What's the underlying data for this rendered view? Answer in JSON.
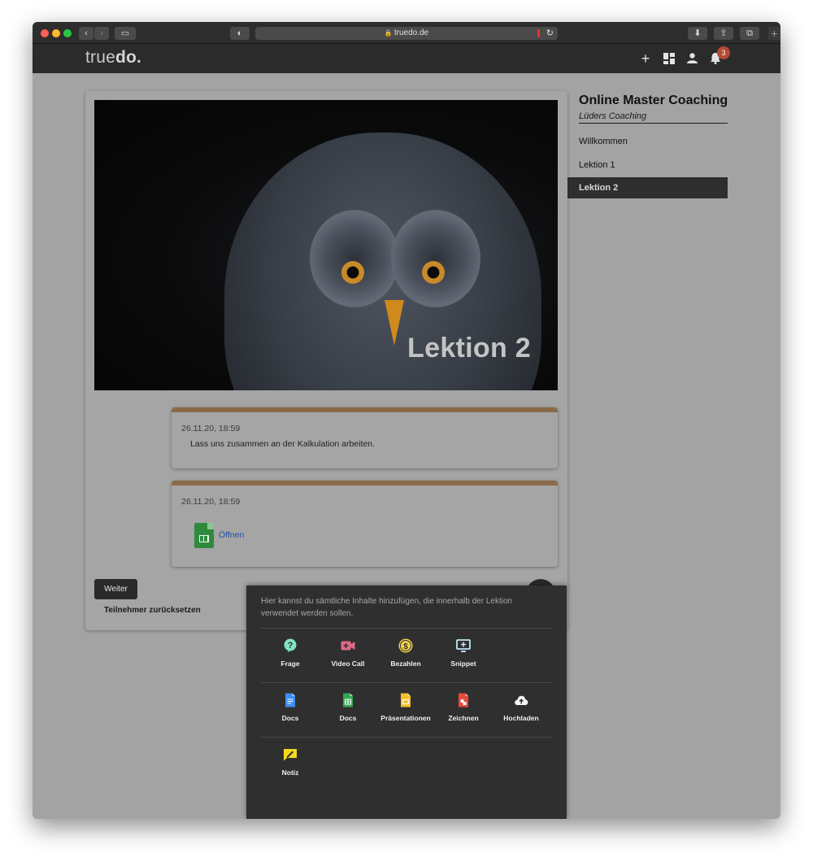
{
  "browser": {
    "url": "truedo.de"
  },
  "header": {
    "logo_light": "true",
    "logo_bold": "do.",
    "notification_count": "3"
  },
  "lesson": {
    "hero_title": "Lektion 2",
    "posts": [
      {
        "date": "26.11.20, 18:59",
        "text": "Lass uns zusammen an der Kalkulation arbeiten."
      },
      {
        "date": "26.11.20, 18:59",
        "link": "Öffnen"
      }
    ],
    "next_button": "Weiter",
    "reset_link": "Teilnehmer zurücksetzen"
  },
  "sidebar": {
    "course_title": "Online Master Coaching",
    "course_subtitle": "Lüders Coaching",
    "items": [
      {
        "label": "Willkommen",
        "active": false
      },
      {
        "label": "Lektion 1",
        "active": false
      },
      {
        "label": "Lektion 2",
        "active": true
      }
    ]
  },
  "add_panel": {
    "description": "Hier kannst du sämtliche Inhalte hinzufügen, die innerhalb der Lektion verwendet werden sollen.",
    "rows": [
      [
        {
          "label": "Frage",
          "icon": "question-icon",
          "color": "#7fe3c5"
        },
        {
          "label": "Video Call",
          "icon": "video-camera-icon",
          "color": "#e06a86"
        },
        {
          "label": "Bezahlen",
          "icon": "dollar-coin-icon",
          "color": "#f2d34a"
        },
        {
          "label": "Snippet",
          "icon": "monitor-plus-icon",
          "color": "#b9ecf6"
        }
      ],
      [
        {
          "label": "Docs",
          "icon": "google-docs-icon",
          "color": "#3f8df2"
        },
        {
          "label": "Docs",
          "icon": "google-sheets-icon",
          "color": "#34a853"
        },
        {
          "label": "Präsentationen",
          "icon": "google-slides-icon",
          "color": "#f6bf26"
        },
        {
          "label": "Zeichnen",
          "icon": "google-drawings-icon",
          "color": "#e4493d"
        },
        {
          "label": "Hochladen",
          "icon": "cloud-upload-icon",
          "color": "#f5f5f5"
        }
      ],
      [
        {
          "label": "Notiz",
          "icon": "note-icon",
          "color": "#f4d91e"
        }
      ]
    ]
  }
}
